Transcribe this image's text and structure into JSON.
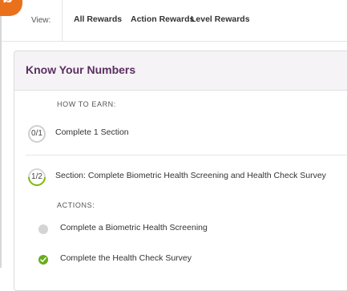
{
  "badge": {
    "letter": "b",
    "color": "#e9711c"
  },
  "filter": {
    "view_label": "View:",
    "tabs": [
      {
        "label": "All Rewards"
      },
      {
        "label": "Action Rewards"
      },
      {
        "label": "Level Rewards"
      }
    ]
  },
  "card": {
    "title": "Know Your Numbers",
    "how_to_earn_label": "HOW TO EARN:",
    "requirements": [
      {
        "progress": "0/1",
        "label": "Complete 1 Section"
      },
      {
        "progress": "1/2",
        "label": "Section: Complete Biometric Health Screening and Health Check Survey"
      }
    ],
    "actions_label": "ACTIONS:",
    "actions": [
      {
        "label": "Complete a Biometric Health Screening",
        "status": "incomplete"
      },
      {
        "label": "Complete the Health Check Survey",
        "status": "complete"
      }
    ]
  },
  "colors": {
    "title": "#5b2e61",
    "progress_green": "#7ab800",
    "check_green": "#6aac1e"
  }
}
